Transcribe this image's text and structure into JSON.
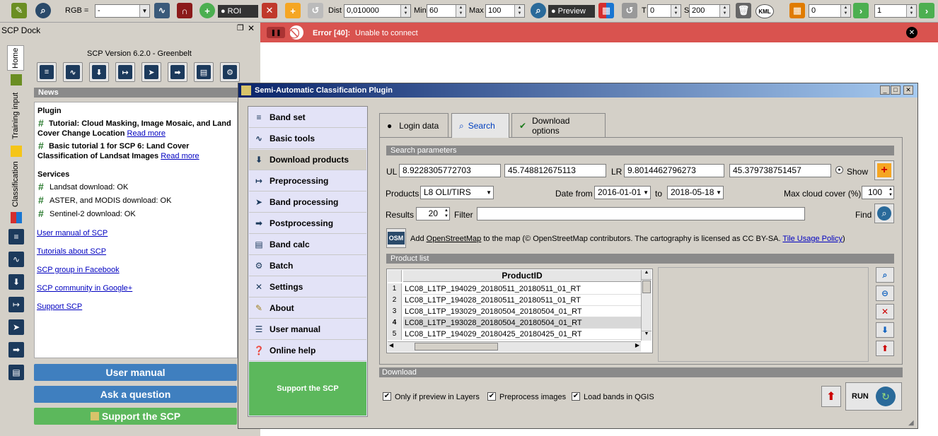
{
  "toolbar": {
    "rgb_label": "RGB =",
    "rgb_value": "-",
    "roi_label": "ROI",
    "dist_label": "Dist",
    "dist_value": "0,010000",
    "min_label": "Min",
    "min_value": "60",
    "max_label": "Max",
    "max_value": "100",
    "preview_label": "Preview",
    "t_label": "T",
    "t_value": "0",
    "s_label": "S",
    "s_value": "200",
    "kml_label": "KML",
    "band_value": "0",
    "step_value": "1"
  },
  "dock": {
    "title": "SCP Dock",
    "version": "SCP Version 6.2.0 - Greenbelt",
    "vertical_tabs": [
      "Home",
      "Training input",
      "Classification"
    ],
    "news_header": "News",
    "plugin_heading": "Plugin",
    "news_items": [
      {
        "title": "Tutorial: Cloud Masking, Image Mosaic, and Land Cover Change Location",
        "link": "Read more"
      },
      {
        "title": "Basic tutorial 1 for SCP 6: Land Cover Classification of Landsat Images",
        "link": "Read more"
      }
    ],
    "services_heading": "Services",
    "services": [
      "Landsat download: OK",
      "ASTER, and MODIS download: OK",
      "Sentinel-2 download: OK"
    ],
    "links": [
      "User manual of SCP",
      "Tutorials about SCP",
      "SCP group in Facebook",
      "SCP community in Google+",
      "Support SCP"
    ],
    "user_manual_btn": "User manual",
    "ask_question_btn": "Ask a question",
    "support_btn": "Support the SCP"
  },
  "error_bar": {
    "code": "Error [40]:",
    "message": "Unable to connect"
  },
  "plugin_window": {
    "title": "Semi-Automatic Classification Plugin",
    "menu": [
      "Band set",
      "Basic tools",
      "Download products",
      "Preprocessing",
      "Band processing",
      "Postprocessing",
      "Band calc",
      "Batch",
      "Settings",
      "About",
      "User manual",
      "Online help"
    ],
    "support_label": "Support the SCP",
    "tabs": [
      "Login data",
      "Search",
      "Download options"
    ],
    "search_params_header": "Search parameters",
    "ul_label": "UL",
    "ul_x": "8.9228305772703",
    "ul_y": "45.748812675113",
    "lr_label": "LR",
    "lr_x": "9.8014462796273",
    "lr_y": "45.379738751457",
    "show_label": "Show",
    "products_label": "Products",
    "products_value": "L8 OLI/TIRS",
    "date_from_label": "Date from",
    "date_from": "2016-01-01",
    "to_label": "to",
    "date_to": "2018-05-18",
    "max_cloud_label": "Max cloud cover (%)",
    "max_cloud_value": "100",
    "results_label": "Results",
    "results_value": "20",
    "filter_label": "Filter",
    "filter_value": "",
    "find_label": "Find",
    "osm_icon_text": "OSM",
    "osm_text_prefix": "Add",
    "osm_link": "OpenStreetMap",
    "osm_text_mid": "to the map  (© OpenStreetMap contributors. The cartography is licensed as CC BY-SA.",
    "osm_tile_link": "Tile Usage Policy",
    "osm_text_end": ")",
    "product_list_header": "Product list",
    "table_header": "ProductID",
    "rows": [
      {
        "n": "1",
        "id": "LC08_L1TP_194029_20180511_20180511_01_RT"
      },
      {
        "n": "2",
        "id": "LC08_L1TP_194028_20180511_20180511_01_RT"
      },
      {
        "n": "3",
        "id": "LC08_L1TP_193029_20180504_20180504_01_RT"
      },
      {
        "n": "4",
        "id": "LC08_L1TP_193028_20180504_20180504_01_RT"
      },
      {
        "n": "5",
        "id": "LC08_L1TP_194029_20180425_20180425_01_RT"
      }
    ],
    "download_header": "Download",
    "only_preview": "Only if preview in Layers",
    "preprocess": "Preprocess images",
    "load_bands": "Load bands in QGIS",
    "run_label": "RUN"
  }
}
